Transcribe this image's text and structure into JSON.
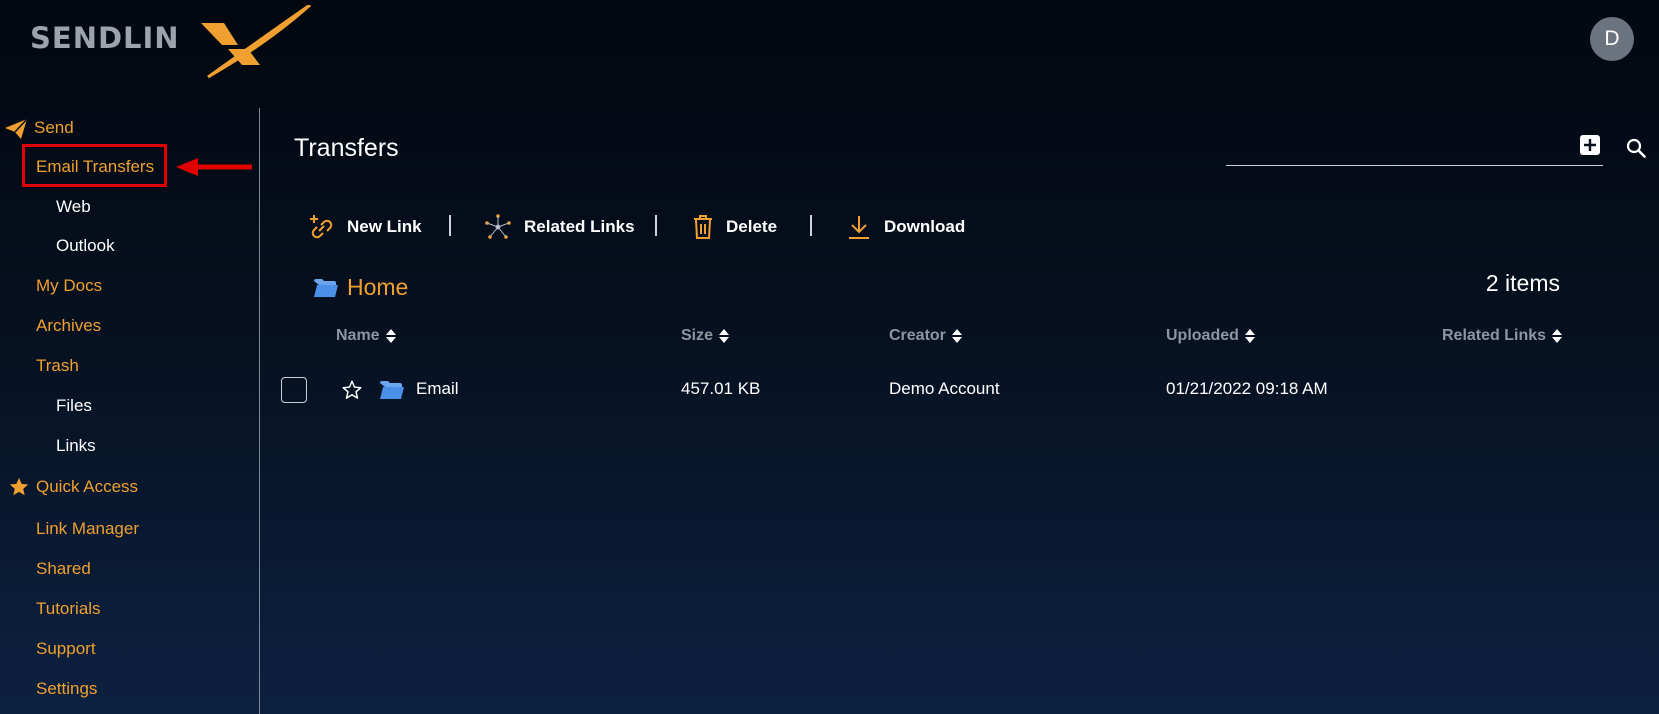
{
  "brand": {
    "logo_text": "SENDLIN",
    "accent_color": "#f0a030"
  },
  "user": {
    "avatar_initial": "D"
  },
  "sidebar": {
    "items": [
      {
        "label": "Send",
        "icon": "paper-plane-icon"
      },
      {
        "label": "Email Transfers",
        "highlighted": true
      },
      {
        "label": "Web"
      },
      {
        "label": "Outlook"
      },
      {
        "label": "My Docs"
      },
      {
        "label": "Archives"
      },
      {
        "label": "Trash"
      },
      {
        "label": "Files"
      },
      {
        "label": "Links"
      },
      {
        "label": "Quick Access",
        "icon": "star-icon"
      },
      {
        "label": "Link Manager"
      },
      {
        "label": "Shared"
      },
      {
        "label": "Tutorials"
      },
      {
        "label": "Support"
      },
      {
        "label": "Settings"
      }
    ]
  },
  "main": {
    "title": "Transfers",
    "toolbar": {
      "new_link": "New Link",
      "related_links": "Related Links",
      "delete": "Delete",
      "download": "Download"
    },
    "breadcrumb": "Home",
    "item_count": "2 items",
    "table": {
      "columns": [
        "Name",
        "Size",
        "Creator",
        "Uploaded",
        "Related Links"
      ],
      "rows": [
        {
          "name": "Email",
          "size": "457.01 KB",
          "creator": "Demo Account",
          "uploaded": "01/21/2022 09:18 AM",
          "related_links": ""
        }
      ]
    }
  },
  "colors": {
    "accent": "#f0a030",
    "annotation": "#e00000",
    "folder": "#4a8fe8"
  }
}
